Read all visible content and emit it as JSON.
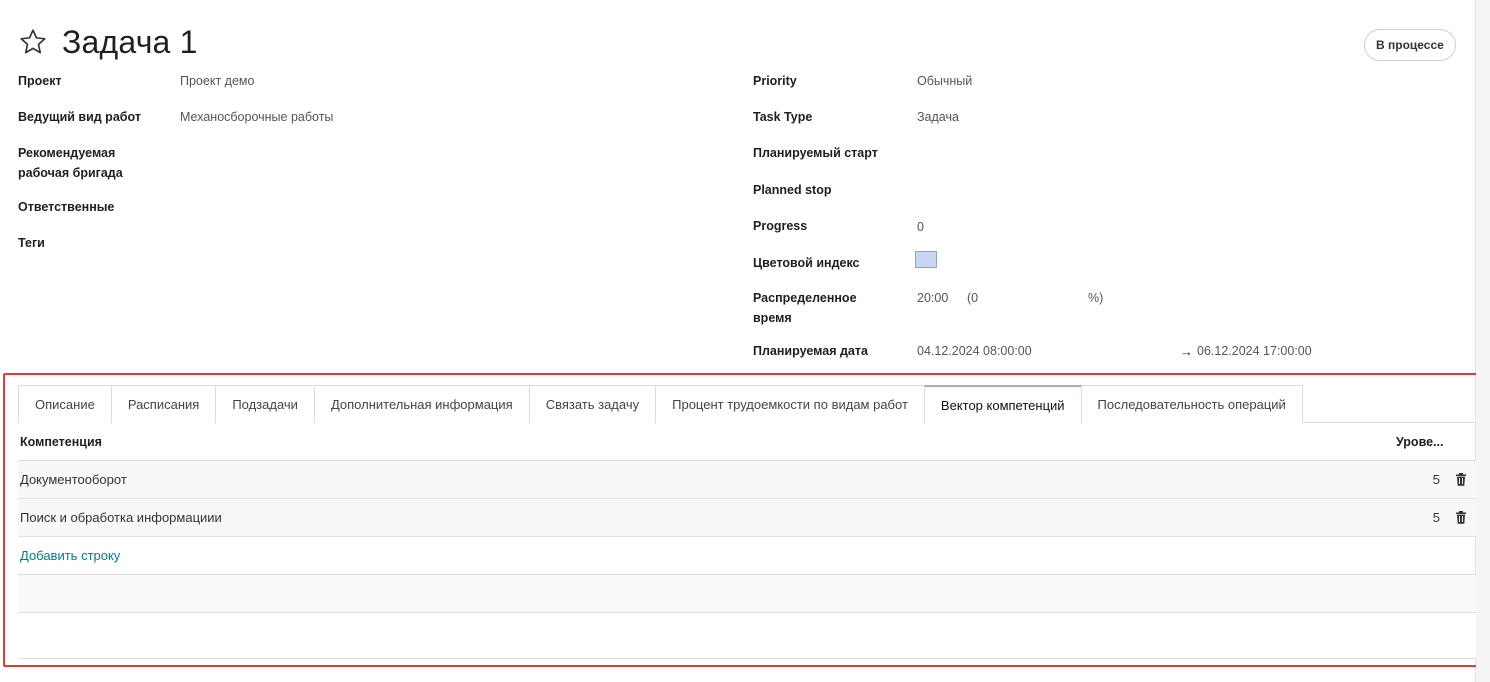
{
  "record": {
    "title": "Задача 1",
    "status": "В процессе"
  },
  "left_fields": {
    "project_label": "Проект",
    "project_value": "Проект демо",
    "work_type_label": "Ведущий вид работ",
    "work_type_value": "Механосборочные работы",
    "brigade_label_line1": "Рекомендуемая",
    "brigade_label_line2": "рабочая бригада",
    "responsible_label": "Ответственные",
    "tags_label": "Теги"
  },
  "right_fields": {
    "priority_label": "Priority",
    "priority_value": "Обычный",
    "task_type_label": "Task Type",
    "task_type_value": "Задача",
    "planned_start_label": "Планируемый старт",
    "planned_stop_label": "Planned stop",
    "progress_label": "Progress",
    "progress_value": "0",
    "color_label": "Цветовой индекс",
    "color_value": "#c7d7f2",
    "allocated_label_line1": "Распределенное",
    "allocated_label_line2": "время",
    "allocated_time": "20:00",
    "allocated_pct_open": "(0",
    "allocated_pct_close": "%)",
    "planned_date_label": "Планируемая дата",
    "planned_date_start": "04.12.2024 08:00:00",
    "planned_date_arrow": "→",
    "planned_date_end": "06.12.2024 17:00:00"
  },
  "tabs": [
    {
      "label": "Описание",
      "active": false
    },
    {
      "label": "Расписания",
      "active": false
    },
    {
      "label": "Подзадачи",
      "active": false
    },
    {
      "label": "Дополнительная информация",
      "active": false
    },
    {
      "label": "Связать задачу",
      "active": false
    },
    {
      "label": "Процент трудоемкости по видам работ",
      "active": false
    },
    {
      "label": "Вектор компетенций",
      "active": true
    },
    {
      "label": "Последовательность операций",
      "active": false
    }
  ],
  "competence_table": {
    "col_competence": "Компетенция",
    "col_level": "Урове...",
    "rows": [
      {
        "competence": "Документооборот",
        "level": "5"
      },
      {
        "competence": "Поиск и обработка информациии",
        "level": "5"
      }
    ],
    "add_row_label": "Добавить строку"
  },
  "icons": {
    "favorite": "star-outline-icon",
    "delete": "trash-icon"
  }
}
